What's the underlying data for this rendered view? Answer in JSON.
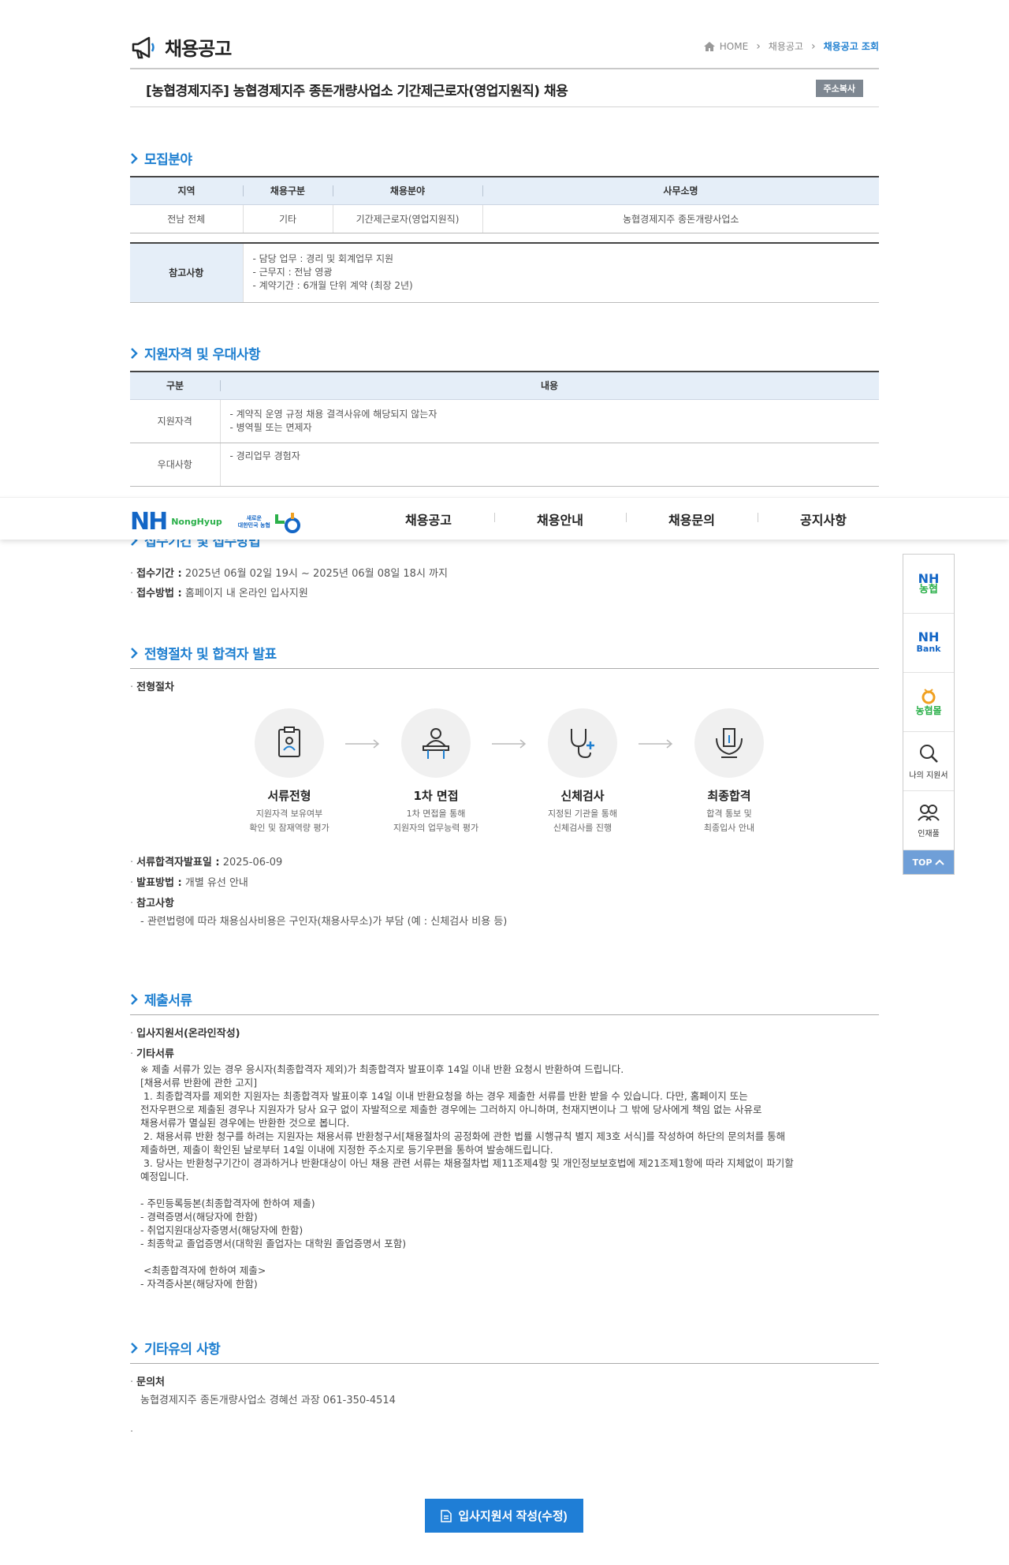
{
  "header": {
    "title": "채용공고",
    "breadcrumb": [
      "HOME",
      "채용공고",
      "채용공고 조회"
    ]
  },
  "job": {
    "title": "[농협경제지주] 농협경제지주 종돈개량사업소 기간제근로자(영업지원직) 채용",
    "copy_button": "주소복사"
  },
  "recruit": {
    "section_title": "모집분야",
    "headers": [
      "지역",
      "채용구분",
      "채용분야",
      "사무소명"
    ],
    "row": [
      "전남 전체",
      "기타",
      "기간제근로자(영업지원직)",
      "농협경제지주 종돈개량사업소"
    ],
    "note_label": "참고사항",
    "notes": [
      "- 담당 업무 : 경리 및 회계업무 지원",
      "- 근무지 : 전남 영광",
      "- 계약기간 : 6개월 단위 계약 (최장 2년)"
    ]
  },
  "qualify": {
    "section_title": "지원자격 및 우대사항",
    "headers": [
      "구분",
      "내용"
    ],
    "rows": [
      {
        "label": "지원자격",
        "lines": [
          "- 계약직 운영 규정 채용 결격사유에 해당되지 않는자",
          "- 병역필 또는 면제자"
        ]
      },
      {
        "label": "우대사항",
        "lines": [
          "- 경리업무 경험자"
        ]
      }
    ]
  },
  "gnb": {
    "logo_nh": "NH",
    "logo_nh_text": "NongHyup",
    "slogan_line1": "새로운",
    "slogan_line2": "대한민국 농협",
    "menu": [
      "채용공고",
      "채용안내",
      "채용문의",
      "공지사항"
    ]
  },
  "apply": {
    "section_title": "접수기간 및 접수방법",
    "period_label": "접수기간 :",
    "period_value": "2025년 06월 02일 19시 ~ 2025년 06월 08일 18시 까지",
    "method_label": "접수방법 :",
    "method_value": "홈페이지 내 온라인 입사지원"
  },
  "process": {
    "section_title": "전형절차 및 합격자 발표",
    "sub_label": "전형절차",
    "steps": [
      {
        "name": "서류전형",
        "desc1": "지원자격 보유여부",
        "desc2": "확인 및 잠재역량 평가"
      },
      {
        "name": "1차 면접",
        "desc1": "1차 면접을 통해",
        "desc2": "지원자의 업무능력 평가"
      },
      {
        "name": "신체검사",
        "desc1": "지정된 기관을 통해",
        "desc2": "신체검사를 진행"
      },
      {
        "name": "최종합격",
        "desc1": "합격 통보 및",
        "desc2": "최종입사 안내"
      }
    ],
    "announce_label": "서류합격자발표일 :",
    "announce_value": "2025-06-09",
    "announce_method_label": "발표방법 :",
    "announce_method_value": "개별 유선 안내",
    "note_label": "참고사항",
    "note_value": "- 관련법령에 따라 채용심사비용은 구인자(채용사무소)가 부담 (예 : 신체검사 비용 등)"
  },
  "documents": {
    "section_title": "제출서류",
    "item1": "입사지원서(온라인작성)",
    "item2": "기타서류",
    "body": "※ 제출 서류가 있는 경우 응시자(최종합격자 제외)가 최종합격자 발표이후 14일 이내 반환 요청시 반환하여 드립니다.\n[채용서류 반환에 관한 고지]\n 1. 최종합격자를 제외한 지원자는 최종합격자 발표이후 14일 이내 반환요청을 하는 경우 제출한 서류를 반환 받을 수 있습니다. 다만, 홈페이지 또는\n전자우편으로 제출된 경우나 지원자가 당사 요구 없이 자발적으로 제출한 경우에는 그러하지 아니하며, 천재지변이나 그 밖에 당사에게 책임 없는 사유로\n채용서류가 멸실된 경우에는 반환한 것으로 봅니다.\n 2. 채용서류 반환 청구를 하려는 지원자는 채용서류 반환청구서[채용절차의 공정화에 관한 법률 시행규칙 별지 제3호 서식]를 작성하여 하단의 문의처를 통해\n제출하면, 제출이 확인된 날로부터 14일 이내에 지정한 주소지로 등기우편을 통하여 발송해드립니다.\n 3. 당사는 반환청구기간이 경과하거나 반환대상이 아닌 채용 관련 서류는 채용절차법 제11조제4항 및 개인정보보호법에 제21조제1항에 따라 지체없이 파기할\n예정입니다.\n\n- 주민등록등본(최종합격자에 한하여 제출)\n- 경력증명서(해당자에 한함)\n- 취업지원대상자증명서(해당자에 한함)\n- 최종학교 졸업증명서(대학원 졸업자는 대학원 졸업증명서 포함)\n\n <최종합격자에 한하여 제출>\n- 자격증사본(해당자에 한함)"
  },
  "etc": {
    "section_title": "기타유의 사항",
    "contact_label": "문의처",
    "contact_value": "농협경제지주 종돈개량사업소 경혜선 과장 061-350-4514"
  },
  "quick": {
    "nh1_top": "NH",
    "nh1_bottom": "농협",
    "nh2_top": "NH",
    "nh2_bottom": "Bank",
    "nh3": "농협몰",
    "my_apply": "나의 지원서",
    "talent": "인재풀",
    "top": "TOP"
  },
  "apply_button": "입사지원서 작성(수정)",
  "colors": {
    "accent": "#1e7fd0",
    "header_bg": "#e5eef8",
    "button": "#1f7ed6",
    "nh_blue": "#1366c6",
    "nh_green": "#2bb04a"
  }
}
